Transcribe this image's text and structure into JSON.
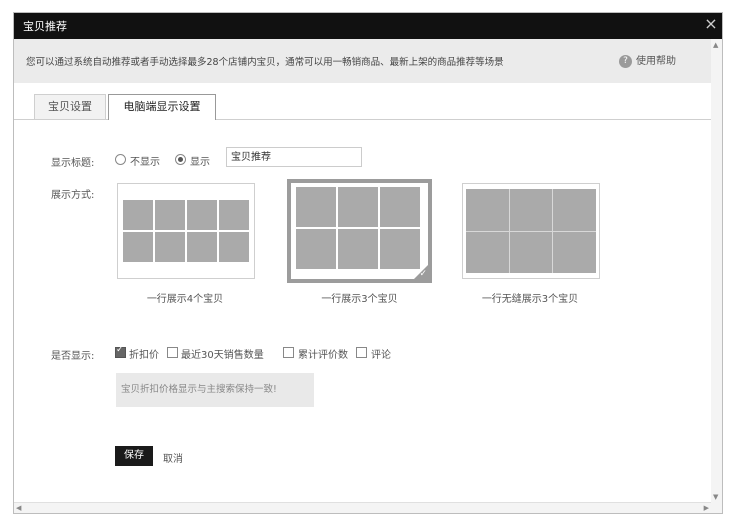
{
  "window": {
    "title": "宝贝推荐",
    "close_icon": "×"
  },
  "notice": {
    "text": "您可以通过系统自动推荐或者手动选择最多28个店铺内宝贝，通常可以用一畅销商品、最新上架的商品推荐等场景",
    "help_label": "使用帮助"
  },
  "tabs": [
    {
      "label": "宝贝设置",
      "active": false
    },
    {
      "label": "电脑端显示设置",
      "active": true
    }
  ],
  "display_title": {
    "label": "显示标题:",
    "options": [
      "不显示",
      "显示"
    ],
    "selected": "显示",
    "value": "宝贝推荐"
  },
  "display_mode": {
    "label": "展示方式:",
    "options": [
      {
        "caption": "一行展示4个宝贝",
        "selected": false
      },
      {
        "caption": "一行展示3个宝贝",
        "selected": true
      },
      {
        "caption": "一行无缝展示3个宝贝",
        "selected": false
      }
    ]
  },
  "show_fields": {
    "label": "是否显示:",
    "options": [
      {
        "label": "折扣价",
        "checked": true
      },
      {
        "label": "最近30天销售数量",
        "checked": false
      },
      {
        "label": "累计评价数",
        "checked": false
      },
      {
        "label": "评论",
        "checked": false
      }
    ]
  },
  "note": "宝贝折扣价格显示与主搜索保持一致!",
  "actions": {
    "save_label": "保存",
    "cancel_label": "取消"
  },
  "colors": {
    "titlebar": "#111111",
    "notice_bg": "#ebebeb",
    "placeholder_gray": "#aaaaaa",
    "save_button": "#1a1a1a"
  }
}
